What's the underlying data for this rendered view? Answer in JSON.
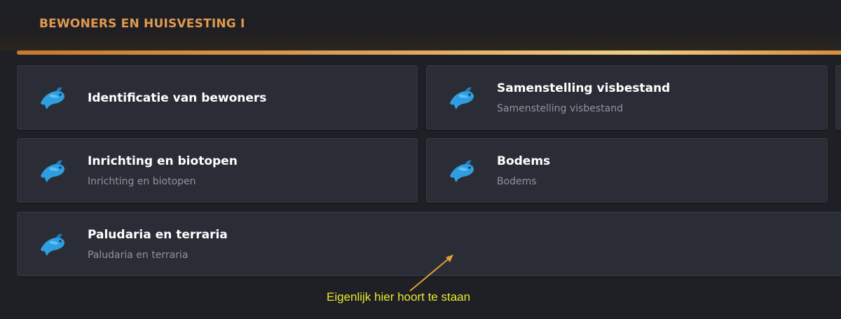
{
  "section": {
    "title": "BEWONERS EN HUISVESTING I"
  },
  "cards": [
    {
      "title": "Identificatie van bewoners",
      "subtitle": "",
      "icon": "fish-icon"
    },
    {
      "title": "Samenstelling visbestand",
      "subtitle": "Samenstelling visbestand",
      "icon": "fish-icon"
    },
    {
      "title": "Inrichting en biotopen",
      "subtitle": "Inrichting en biotopen",
      "icon": "fish-icon"
    },
    {
      "title": "Bodems",
      "subtitle": "Bodems",
      "icon": "fish-icon"
    },
    {
      "title": "Paludaria en terraria",
      "subtitle": "Paludaria en terraria",
      "icon": "fish-icon"
    }
  ],
  "annotation": {
    "text": "Eigenlijk hier hoort te staan"
  },
  "colors": {
    "background": "#1f2025",
    "card": "#2b2d36",
    "accent": "#e0994f",
    "fish": "#2f9ee0",
    "annotation_text": "#e8e830",
    "annotation_arrow": "#e0a030"
  }
}
